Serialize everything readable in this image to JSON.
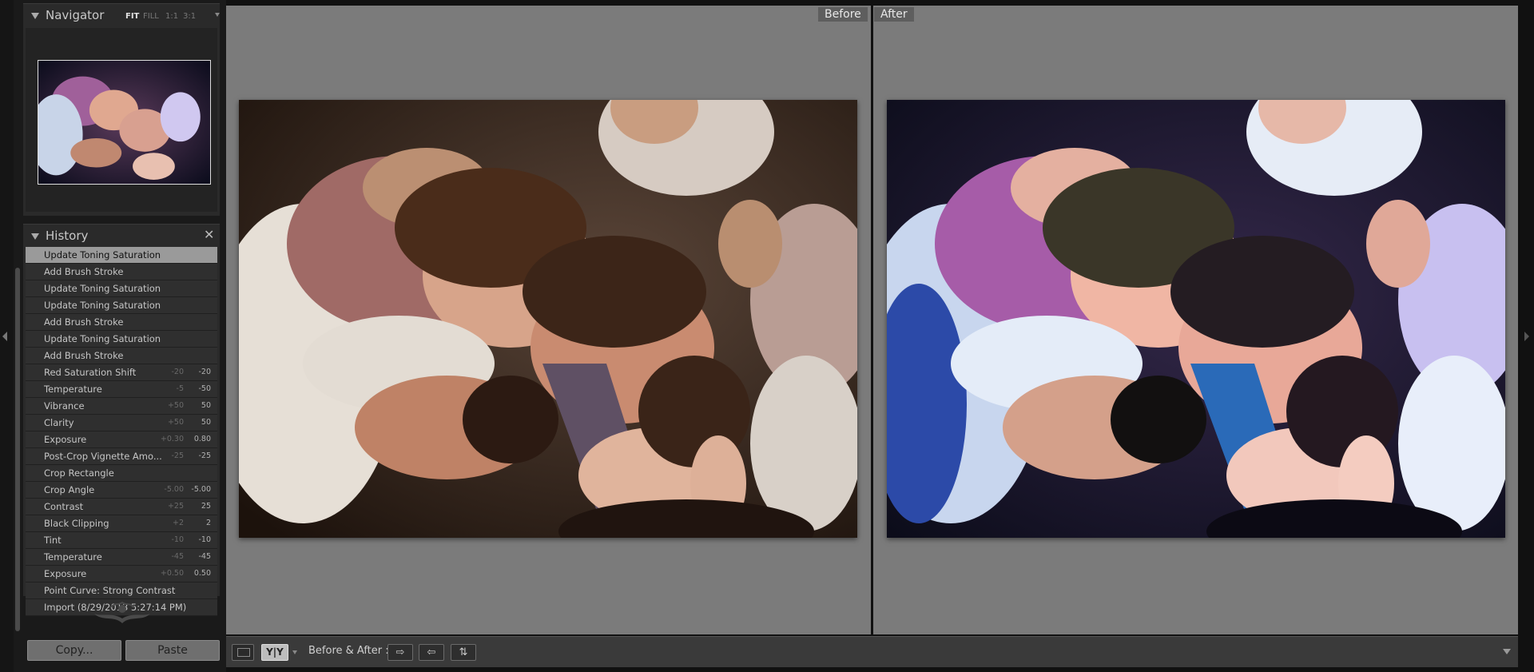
{
  "navigator": {
    "title": "Navigator",
    "zoom_options": [
      "FIT",
      "FILL",
      "1:1",
      "3:1"
    ],
    "active_zoom": "FIT"
  },
  "history": {
    "title": "History",
    "close_glyph": "✕",
    "items": [
      {
        "label": "Update Toning Saturation",
        "before": "",
        "after": "",
        "selected": true
      },
      {
        "label": "Add Brush Stroke",
        "before": "",
        "after": ""
      },
      {
        "label": "Update Toning Saturation",
        "before": "",
        "after": ""
      },
      {
        "label": "Update Toning Saturation",
        "before": "",
        "after": ""
      },
      {
        "label": "Add Brush Stroke",
        "before": "",
        "after": ""
      },
      {
        "label": "Update Toning Saturation",
        "before": "",
        "after": ""
      },
      {
        "label": "Add Brush Stroke",
        "before": "",
        "after": ""
      },
      {
        "label": "Red Saturation Shift",
        "before": "-20",
        "after": "-20"
      },
      {
        "label": "Temperature",
        "before": "-5",
        "after": "-50"
      },
      {
        "label": "Vibrance",
        "before": "+50",
        "after": "50"
      },
      {
        "label": "Clarity",
        "before": "+50",
        "after": "50"
      },
      {
        "label": "Exposure",
        "before": "+0.30",
        "after": "0.80"
      },
      {
        "label": "Post-Crop Vignette Amo...",
        "before": "-25",
        "after": "-25"
      },
      {
        "label": "Crop Rectangle",
        "before": "",
        "after": ""
      },
      {
        "label": "Crop Angle",
        "before": "-5.00",
        "after": "-5.00"
      },
      {
        "label": "Contrast",
        "before": "+25",
        "after": "25"
      },
      {
        "label": "Black Clipping",
        "before": "+2",
        "after": "2"
      },
      {
        "label": "Tint",
        "before": "-10",
        "after": "-10"
      },
      {
        "label": "Temperature",
        "before": "-45",
        "after": "-45"
      },
      {
        "label": "Exposure",
        "before": "+0.50",
        "after": "0.50"
      },
      {
        "label": "Point Curve: Strong Contrast",
        "before": "",
        "after": ""
      },
      {
        "label": "Import (8/29/2013 5:27:14 PM)",
        "before": "",
        "after": ""
      }
    ]
  },
  "buttons": {
    "copy": "Copy...",
    "paste": "Paste"
  },
  "compare": {
    "before_label": "Before",
    "after_label": "After"
  },
  "toolbar": {
    "view_label": "Y|Y",
    "before_after_label": "Before & After :",
    "copy_before_to_after": "⇨",
    "copy_after_to_before": "⇦",
    "swap": "⇅"
  },
  "colors": {
    "panel_bg": "#2a2a2a",
    "main_bg": "#7b7b7b",
    "selected_row": "#9a9a9a"
  }
}
